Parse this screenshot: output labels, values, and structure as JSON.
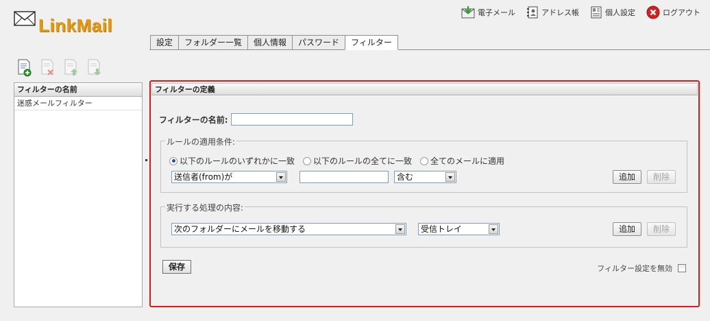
{
  "app": {
    "logo_text": "LinkMail"
  },
  "topnav": [
    {
      "label": "電子メール",
      "icon": "mail-download-icon"
    },
    {
      "label": "アドレス帳",
      "icon": "address-book-icon"
    },
    {
      "label": "個人設定",
      "icon": "personal-settings-icon"
    },
    {
      "label": "ログアウト",
      "icon": "logout-icon"
    }
  ],
  "tabs": [
    {
      "label": "設定",
      "active": false
    },
    {
      "label": "フォルダー一覧",
      "active": false
    },
    {
      "label": "個人情報",
      "active": false
    },
    {
      "label": "パスワード",
      "active": false
    },
    {
      "label": "フィルター",
      "active": true
    }
  ],
  "toolbar": [
    {
      "icon": "new-filter-icon",
      "enabled": true
    },
    {
      "icon": "delete-filter-icon",
      "enabled": false
    },
    {
      "icon": "move-up-icon",
      "enabled": false
    },
    {
      "icon": "move-down-icon",
      "enabled": false
    }
  ],
  "filter_list": {
    "header": "フィルターの名前",
    "items": [
      "迷惑メールフィルター"
    ]
  },
  "definition": {
    "header": "フィルターの定義",
    "name_label": "フィルターの名前:",
    "name_value": "",
    "rules": {
      "legend": "ルールの適用条件:",
      "options": [
        {
          "label": "以下のルールのいずれかに一致",
          "selected": true
        },
        {
          "label": "以下のルールの全てに一致",
          "selected": false
        },
        {
          "label": "全てのメールに適用",
          "selected": false
        }
      ],
      "field_select": "送信者(from)が",
      "value_input": "",
      "operator_select": "含む",
      "add_label": "追加",
      "delete_label": "削除"
    },
    "actions": {
      "legend": "実行する処理の内容:",
      "action_select": "次のフォルダーにメールを移動する",
      "folder_select": "受信トレイ",
      "add_label": "追加",
      "delete_label": "削除"
    },
    "save_label": "保存",
    "disable_label": "フィルター設定を無効",
    "disable_checked": false
  },
  "colors": {
    "highlight_border": "#e01818",
    "logo": "#e09a1a"
  }
}
